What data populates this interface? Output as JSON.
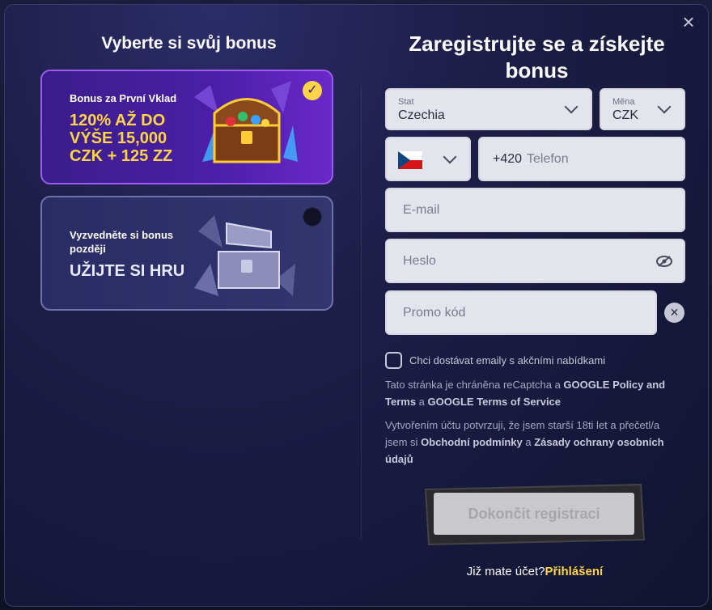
{
  "left": {
    "title": "Vyberte si svůj bonus",
    "cards": [
      {
        "small": "Bonus za První Vklad",
        "big": "120% AŽ DO VÝŠE 15,000 CZK + 125 ZZ",
        "selected": true
      },
      {
        "small": "Vyzvedněte si bonus později",
        "big": "UŽIJTE SI HRU",
        "selected": false
      }
    ]
  },
  "right": {
    "title": "Zaregistrujte se a získejte bonus",
    "country": {
      "label": "Stat",
      "value": "Czechia"
    },
    "currency": {
      "label": "Měna",
      "value": "CZK"
    },
    "phone": {
      "prefix": "+420",
      "placeholder": "Telefon",
      "flag": "czech-flag"
    },
    "email_placeholder": "E-mail",
    "password_placeholder": "Heslo",
    "promo_placeholder": "Promo kód",
    "newsletter_label": "Chci dostávat emaily s akčními nabídkami",
    "legal_1": {
      "text_a": "Tato stránka je chráněna reCaptcha a ",
      "link_a": "GOOGLE Policy and Terms",
      "text_b": " a ",
      "link_b": "GOOGLE Terms of Service"
    },
    "legal_2": {
      "text_a": "Vytvořením účtu potvrzuji, že jsem starší 18ti let a přečetl/a jsem si ",
      "link_a": "Obchodní podmínky",
      "text_b": " a ",
      "link_b": "Zásady ochrany osobních údajů"
    },
    "submit_label": "Dokončit registraci",
    "login_prompt": "Již mate účet?",
    "login_link": "Přihlášení"
  },
  "colors": {
    "accent": "#ffd447",
    "card_selected_border": "#9b5cf0",
    "modal_bg": "#1d1d46"
  },
  "icons": {
    "close": "close-icon",
    "check": "check-icon",
    "eye": "eye-off-icon",
    "clear": "clear-icon",
    "chevron": "chevron-down-icon"
  }
}
